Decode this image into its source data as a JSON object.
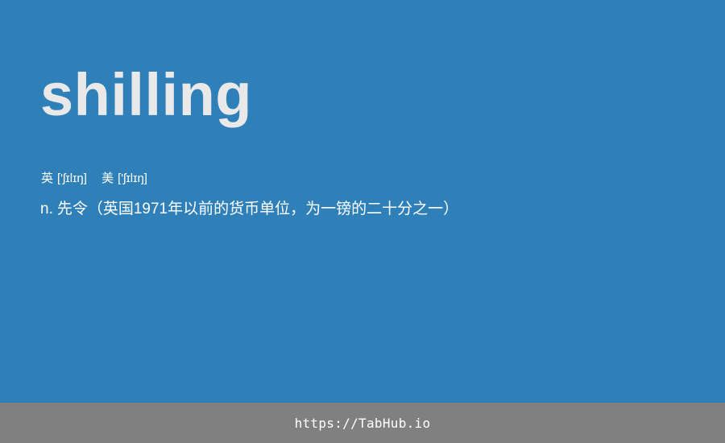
{
  "colors": {
    "background": "#2f80b9",
    "word": "#e9e9e9",
    "text": "#ffffff",
    "footer_background": "#808080"
  },
  "entry": {
    "word": "shilling",
    "phonetics": {
      "uk_label": "英",
      "uk_ipa": "['ʃɪlɪŋ]",
      "us_label": "美",
      "us_ipa": "['ʃɪlɪŋ]"
    },
    "definition": {
      "part_of_speech": "n.",
      "text": "先令（英国1971年以前的货币单位，为一镑的二十分之一）"
    }
  },
  "footer": {
    "url": "https://TabHub.io"
  }
}
